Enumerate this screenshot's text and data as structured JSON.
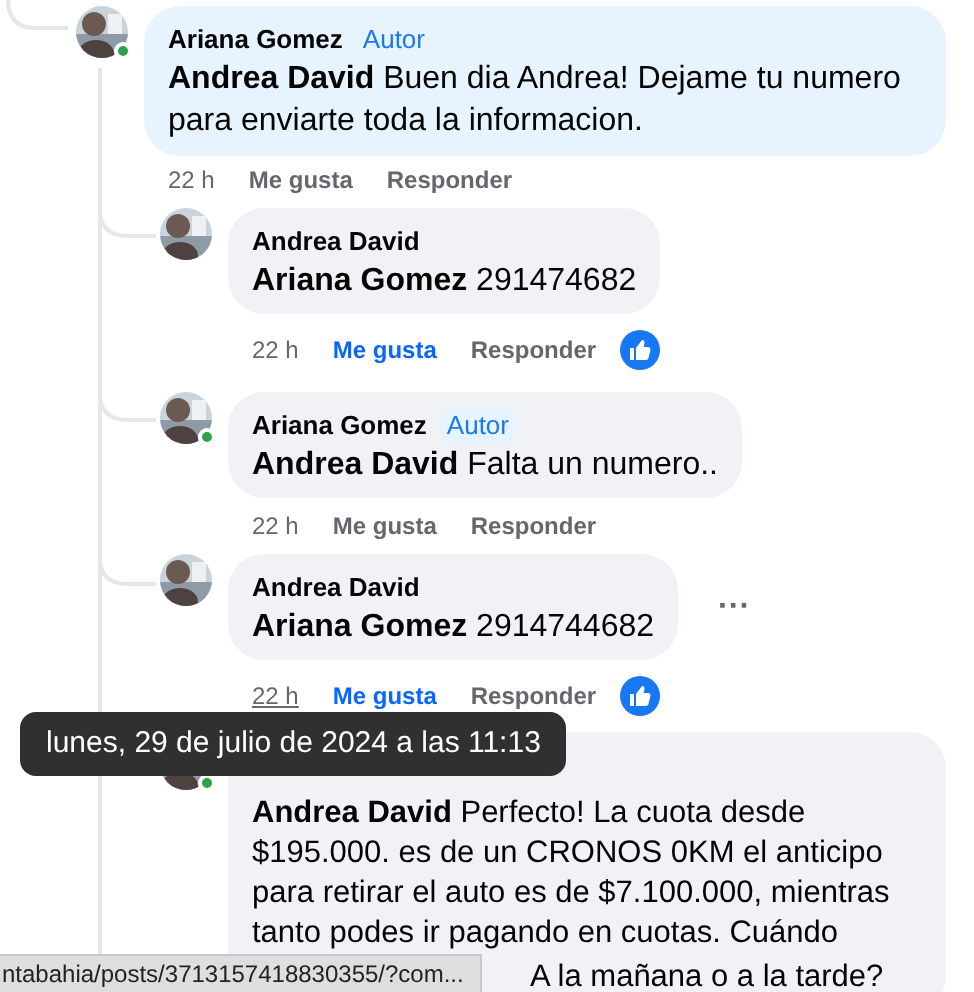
{
  "comments": [
    {
      "author": "Ariana Gomez",
      "badge": "Autor",
      "online": true,
      "mention": "Andrea David",
      "text": "Buen dia Andrea! Dejame tu numero para enviarte toda la informacion.",
      "time": "22 h",
      "like": "Me gusta",
      "reply": "Responder",
      "liked": false,
      "nested": false
    },
    {
      "author": "Andrea David",
      "online": false,
      "mention": "Ariana Gomez",
      "text": "291474682",
      "time": "22 h",
      "like": "Me gusta",
      "reply": "Responder",
      "liked": true,
      "nested": true
    },
    {
      "author": "Ariana Gomez",
      "badge": "Autor",
      "online": true,
      "mention": "Andrea David",
      "text": "Falta un numero..",
      "time": "22 h",
      "like": "Me gusta",
      "reply": "Responder",
      "liked": false,
      "nested": true
    },
    {
      "author": "Andrea David",
      "online": false,
      "mention": "Ariana Gomez",
      "text": "2914744682",
      "time": "22 h",
      "like": "Me gusta",
      "reply": "Responder",
      "liked": true,
      "nested": true,
      "hovered": true,
      "more": "···"
    },
    {
      "online": true,
      "mention": "Andrea David",
      "text": "Perfecto! La cuota desde $195.000. es de un CRONOS 0KM el anticipo para retirar el auto es de $7.100.000, mientras tanto podes ir pagando en cuotas. Cuándo",
      "text_tail": "A la mañana o a la tarde?",
      "nested": true
    }
  ],
  "tooltip": "lunes, 29 de julio de 2024 a las 11:13",
  "status_bar": "ntabahia/posts/3713157418830355/?com..."
}
